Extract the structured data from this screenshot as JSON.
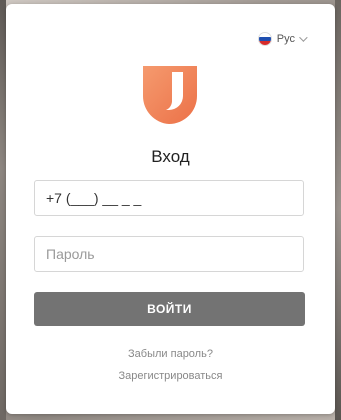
{
  "language": {
    "label": "Рус",
    "flag_colors": [
      "#ffffff",
      "#1f4fb0",
      "#d62b2b"
    ]
  },
  "brand": {
    "logo_color": "#f0855a"
  },
  "login": {
    "title": "Вход",
    "phone_value": "+7 (___) __ _ _",
    "password_placeholder": "Пароль",
    "submit_label": "ВОЙТИ",
    "forgot_label": "Забыли пароль?",
    "register_label": "Зарегистрироваться"
  },
  "colors": {
    "button_bg": "#737373",
    "accent": "#f0855a"
  }
}
